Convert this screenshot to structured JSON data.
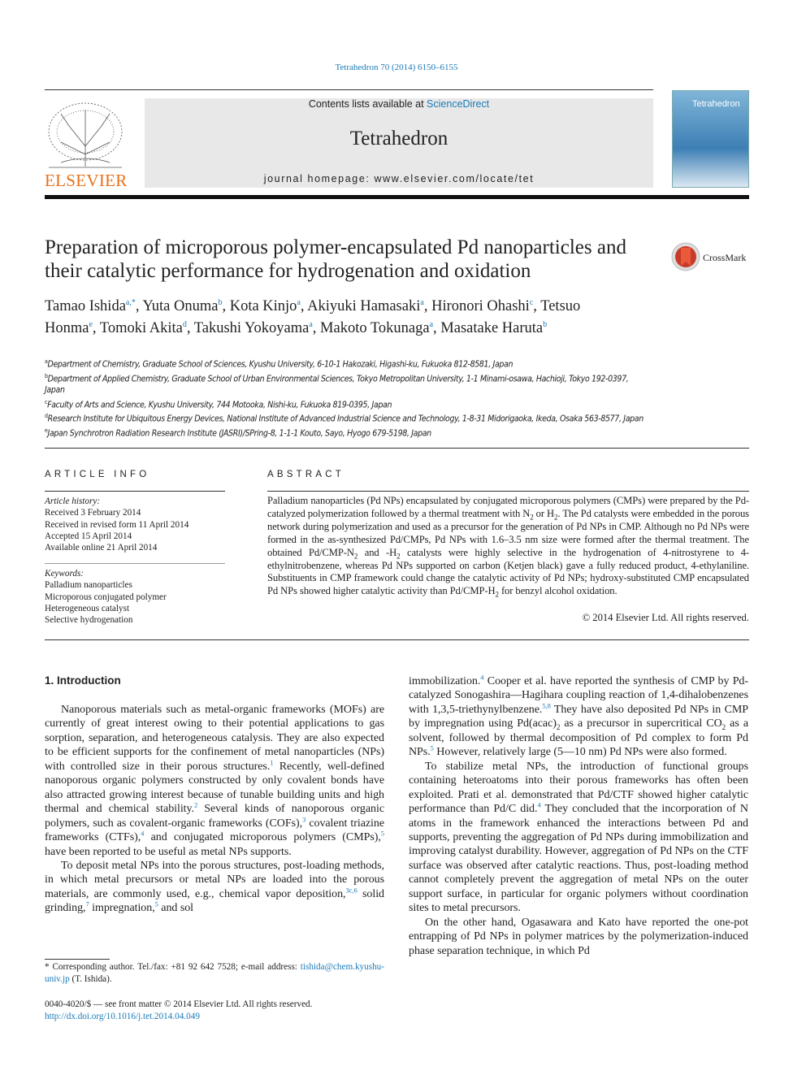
{
  "header": {
    "citation": "Tetrahedron 70 (2014) 6150–6155",
    "publisher_logo_text": "ELSEVIER",
    "contents_prefix": "Contents lists available at ",
    "contents_link": "ScienceDirect",
    "journal_name": "Tetrahedron",
    "homepage_prefix": "journal homepage: ",
    "homepage_url": "www.elsevier.com/locate/tet",
    "cover_title": "Tetrahedron",
    "crossmark_label": "CrossMark",
    "accent_color": "#1a7ab8",
    "logo_color": "#e8701a"
  },
  "article": {
    "title": "Preparation of microporous polymer-encapsulated Pd nanoparticles and their catalytic performance for hydrogenation and oxidation",
    "authors": [
      {
        "name": "Tamao Ishida",
        "aff": "a,*"
      },
      {
        "name": "Yuta Onuma",
        "aff": "b"
      },
      {
        "name": "Kota Kinjo",
        "aff": "a"
      },
      {
        "name": "Akiyuki Hamasaki",
        "aff": "a"
      },
      {
        "name": "Hironori Ohashi",
        "aff": "c"
      },
      {
        "name": "Tetsuo Honma",
        "aff": "e"
      },
      {
        "name": "Tomoki Akita",
        "aff": "d"
      },
      {
        "name": "Takushi Yokoyama",
        "aff": "a"
      },
      {
        "name": "Makoto Tokunaga",
        "aff": "a"
      },
      {
        "name": "Masatake Haruta",
        "aff": "b"
      }
    ],
    "affiliations": [
      {
        "key": "a",
        "text": "Department of Chemistry, Graduate School of Sciences, Kyushu University, 6-10-1 Hakozaki, Higashi-ku, Fukuoka 812-8581, Japan"
      },
      {
        "key": "b",
        "text": "Department of Applied Chemistry, Graduate School of Urban Environmental Sciences, Tokyo Metropolitan University, 1-1 Minami-osawa, Hachioji, Tokyo 192-0397, Japan"
      },
      {
        "key": "c",
        "text": "Faculty of Arts and Science, Kyushu University, 744 Motooka, Nishi-ku, Fukuoka 819-0395, Japan"
      },
      {
        "key": "d",
        "text": "Research Institute for Ubiquitous Energy Devices, National Institute of Advanced Industrial Science and Technology, 1-8-31 Midorigaoka, Ikeda, Osaka 563-8577, Japan"
      },
      {
        "key": "e",
        "text": "Japan Synchrotron Radiation Research Institute (JASRI)/SPring-8, 1-1-1 Kouto, Sayo, Hyogo 679-5198, Japan"
      }
    ]
  },
  "article_info": {
    "heading": "ARTICLE INFO",
    "history_label": "Article history:",
    "history": [
      "Received 3 February 2014",
      "Received in revised form 11 April 2014",
      "Accepted 15 April 2014",
      "Available online 21 April 2014"
    ],
    "keywords_label": "Keywords:",
    "keywords": [
      "Palladium nanoparticles",
      "Microporous conjugated polymer",
      "Heterogeneous catalyst",
      "Selective hydrogenation"
    ]
  },
  "abstract": {
    "heading": "ABSTRACT",
    "segments": [
      {
        "t": "Palladium nanoparticles (Pd NPs) encapsulated by conjugated microporous polymers (CMPs) were prepared by the Pd-catalyzed polymerization followed by a thermal treatment with N"
      },
      {
        "sub": "2"
      },
      {
        "t": " or H"
      },
      {
        "sub": "2"
      },
      {
        "t": ". The Pd catalysts were embedded in the porous network during polymerization and used as a precursor for the generation of Pd NPs in CMP. Although no Pd NPs were formed in the as-synthesized Pd/CMPs, Pd NPs with 1.6–3.5 nm size were formed after the thermal treatment. The obtained Pd/CMP-N"
      },
      {
        "sub": "2"
      },
      {
        "t": " and -H"
      },
      {
        "sub": "2"
      },
      {
        "t": " catalysts were highly selective in the hydrogenation of 4-nitrostyrene to 4-ethylnitrobenzene, whereas Pd NPs supported on carbon (Ketjen black) gave a fully reduced product, 4-ethylaniline. Substituents in CMP framework could change the catalytic activity of Pd NPs; hydroxy-substituted CMP encapsulated Pd NPs showed higher catalytic activity than Pd/CMP-H"
      },
      {
        "sub": "2"
      },
      {
        "t": " for benzyl alcohol oxidation."
      }
    ],
    "copyright": "© 2014 Elsevier Ltd. All rights reserved."
  },
  "body": {
    "section_heading": "1.  Introduction",
    "left_paragraphs": [
      [
        {
          "t": "Nanoporous materials such as metal-organic frameworks (MOFs) are currently of great interest owing to their potential applications to gas sorption, separation, and heterogeneous catalysis. They are also expected to be efficient supports for the confinement of metal nanoparticles (NPs) with controlled size in their porous structures."
        },
        {
          "sup": "1"
        },
        {
          "t": " Recently, well-defined nanoporous organic polymers constructed by only covalent bonds have also attracted growing interest because of tunable building units and high thermal and chemical stability."
        },
        {
          "sup": "2"
        },
        {
          "t": " Several kinds of nanoporous organic polymers, such as covalent-organic frameworks (COFs),"
        },
        {
          "sup": "3"
        },
        {
          "t": " covalent triazine frameworks (CTFs),"
        },
        {
          "sup": "4"
        },
        {
          "t": " and conjugated microporous polymers (CMPs),"
        },
        {
          "sup": "5"
        },
        {
          "t": " have been reported to be useful as metal NPs supports."
        }
      ],
      [
        {
          "t": "To deposit metal NPs into the porous structures, post-loading methods, in which metal precursors or metal NPs are loaded into the porous materials, are commonly used, e.g., chemical vapor deposition,"
        },
        {
          "sup": "3c,6"
        },
        {
          "t": " solid grinding,"
        },
        {
          "sup": "7"
        },
        {
          "t": " impregnation,"
        },
        {
          "sup": "5"
        },
        {
          "t": " and sol"
        }
      ]
    ],
    "right_paragraphs": [
      [
        {
          "t": "immobilization."
        },
        {
          "sup": "4"
        },
        {
          "t": " Cooper et al. have reported the synthesis of CMP by Pd-catalyzed Sonogashira—Hagihara coupling reaction of 1,4-dihalobenzenes with 1,3,5-triethynylbenzene."
        },
        {
          "sup": "5,8"
        },
        {
          "t": " They have also deposited Pd NPs in CMP by impregnation using Pd(acac)"
        },
        {
          "sub": "2"
        },
        {
          "t": " as a precursor in supercritical CO"
        },
        {
          "sub": "2"
        },
        {
          "t": " as a solvent, followed by thermal decomposition of Pd complex to form Pd NPs."
        },
        {
          "sup": "5"
        },
        {
          "t": " However, relatively large (5—10 nm) Pd NPs were also formed."
        }
      ],
      [
        {
          "t": "To stabilize metal NPs, the introduction of functional groups containing heteroatoms into their porous frameworks has often been exploited. Prati et al. demonstrated that Pd/CTF showed higher catalytic performance than Pd/C did."
        },
        {
          "sup": "4"
        },
        {
          "t": " They concluded that the incorporation of N atoms in the framework enhanced the interactions between Pd and supports, preventing the aggregation of Pd NPs during immobilization and improving catalyst durability. However, aggregation of Pd NPs on the CTF surface was observed after catalytic reactions. Thus, post-loading method cannot completely prevent the aggregation of metal NPs on the outer support surface, in particular for organic polymers without coordination sites to metal precursors."
        }
      ],
      [
        {
          "t": "On the other hand, Ogasawara and Kato have reported the one-pot entrapping of Pd NPs in polymer matrices by the polymerization-induced phase separation technique, in which Pd"
        }
      ]
    ]
  },
  "footnote": {
    "text": "* Corresponding author. Tel./fax: +81 92 642 7528; e-mail address: ",
    "email": "tishida@chem.kyushu-univ.jp",
    "suffix": " (T. Ishida)."
  },
  "front_matter": {
    "issn": "0040-4020/$ — see front matter © 2014 Elsevier Ltd. All rights reserved.",
    "doi": "http://dx.doi.org/10.1016/j.tet.2014.04.049"
  }
}
